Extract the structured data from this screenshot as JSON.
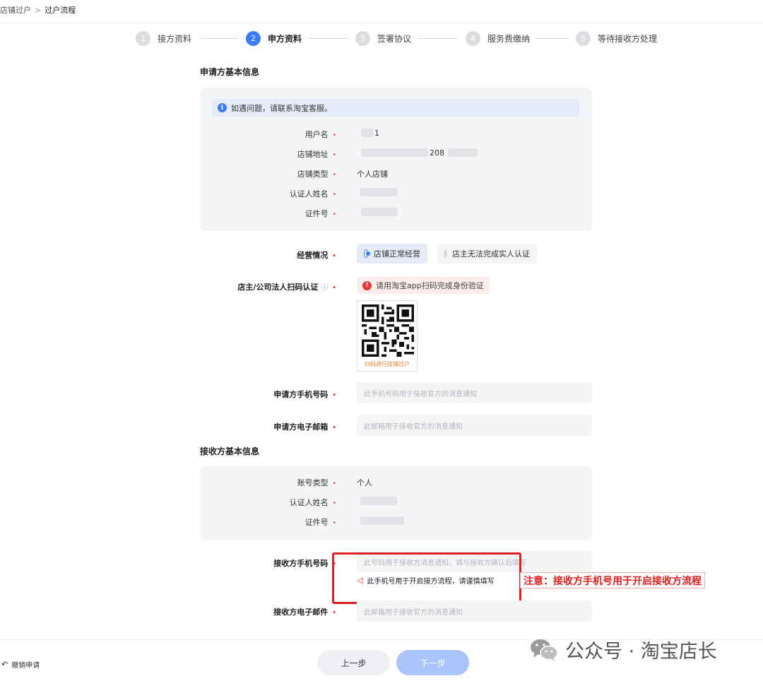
{
  "breadcrumb": {
    "parent": "店铺过户",
    "separator": ">",
    "current": "过户流程"
  },
  "steps": [
    {
      "num": "1",
      "label": "接方资料"
    },
    {
      "num": "2",
      "label": "申方资料"
    },
    {
      "num": "3",
      "label": "签署协议"
    },
    {
      "num": "4",
      "label": "服务费缴纳"
    },
    {
      "num": "5",
      "label": "等待接收方处理"
    }
  ],
  "applicant": {
    "title": "申请方基本信息",
    "notice": "如遇问题，请联系淘宝客服。",
    "fields": [
      {
        "label": "用户名",
        "value": "",
        "value_hint": "1"
      },
      {
        "label": "店铺地址",
        "value": "",
        "value_hint": "208"
      },
      {
        "label": "店铺类型",
        "value": "个人店铺"
      },
      {
        "label": "认证人姓名",
        "value": ""
      },
      {
        "label": "证件号",
        "value": ""
      }
    ],
    "business": {
      "label": "经营情况",
      "options": [
        "店铺正常经营",
        "店主无法完成实人认证"
      ],
      "selected": 0
    },
    "scan": {
      "label": "店主/公司法人扫码认证",
      "help_icon": "question-circle-icon",
      "warning": "请用淘宝app扫码完成身份验证",
      "qr_caption": "扫码进行店铺过户"
    },
    "phone": {
      "label": "申请方手机号码",
      "placeholder": "此手机号码用于接收官方的消息通知"
    },
    "email": {
      "label": "申请方电子邮箱",
      "placeholder": "此邮箱用于接收官方的消息通知"
    }
  },
  "receiver": {
    "title": "接收方基本信息",
    "fields": [
      {
        "label": "账号类型",
        "value": "个人"
      },
      {
        "label": "认证人姓名",
        "value": ""
      },
      {
        "label": "证件号",
        "value": ""
      }
    ],
    "phone": {
      "label": "接收方手机号码",
      "placeholder": "此号码用于接收方消息通知，请与接收方确认后填写",
      "tip": "此手机号用于开启接方流程，请谨慎填写"
    },
    "email": {
      "label": "接收方电子邮件",
      "placeholder": "此邮箱用于接收官方的消息通知"
    }
  },
  "annotation": "注意：接收方手机号用于开启接收方流程",
  "buttons": {
    "prev": "上一步",
    "next": "下一步"
  },
  "cancel": "撤销申请",
  "watermark": "公众号 · 淘宝店长",
  "colors": {
    "primary": "#3a7bfa",
    "required": "#e23a3a",
    "highlight": "#e02020"
  }
}
